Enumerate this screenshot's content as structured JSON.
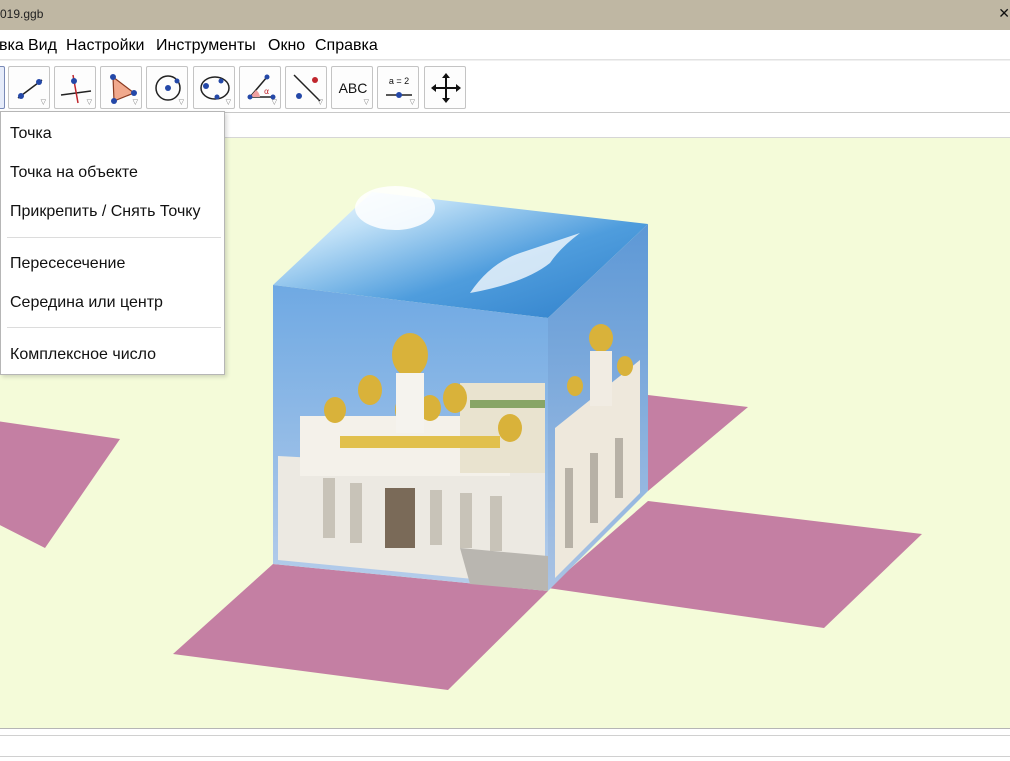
{
  "window": {
    "title": "019.ggb",
    "close_glyph": "✕"
  },
  "menu": [
    "вка",
    "Вид",
    "Настройки",
    "Инструменты",
    "Окно",
    "Справка"
  ],
  "toolbar": {
    "tools": [
      {
        "name": "move-tool"
      },
      {
        "name": "line-tool"
      },
      {
        "name": "perpendicular-tool"
      },
      {
        "name": "polygon-tool"
      },
      {
        "name": "circle-tool"
      },
      {
        "name": "conic-tool"
      },
      {
        "name": "angle-tool"
      },
      {
        "name": "reflect-tool"
      },
      {
        "name": "text-tool",
        "label": "ABC"
      },
      {
        "name": "slider-tool",
        "label": "a = 2"
      },
      {
        "name": "move-graphics-tool"
      }
    ]
  },
  "dropdown": {
    "items": [
      "Точка",
      "Точка на объекте",
      "Прикрепить / Снять Точку",
      "Пересесечение",
      "Середина или центр",
      "Комплексное число"
    ]
  },
  "colors": {
    "canvas": "#f4fbd9",
    "net_face": "#c47fa3",
    "sky": "#5aa4df",
    "dome_gold": "#d9b23a"
  }
}
